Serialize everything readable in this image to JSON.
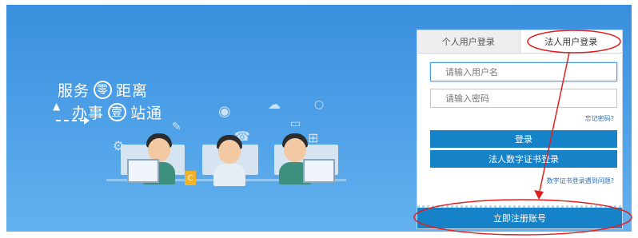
{
  "banner": {
    "slogan_line1_a": "服务",
    "slogan_line1_circle": "零",
    "slogan_line1_b": "距离",
    "slogan_line2_a": "办事",
    "slogan_line2_circle": "壹",
    "slogan_line2_b": "站通",
    "phone_icon_char": "C"
  },
  "login": {
    "tabs": [
      {
        "label": "个人用户登录",
        "active": false
      },
      {
        "label": "法人用户登录",
        "active": true
      }
    ],
    "username_placeholder": "请输入用户名",
    "password_placeholder": "请输入密码",
    "forgot_password": "忘记密码?",
    "login_button": "登录",
    "cert_login_button": "法人数字证书登录",
    "cert_help_link": "数字证书登录遇到问题?",
    "register_button": "立即注册账号"
  },
  "colors": {
    "banner_blue": "#4b9ee6",
    "button_blue": "#1683c8",
    "annotation_red": "#e02020"
  }
}
